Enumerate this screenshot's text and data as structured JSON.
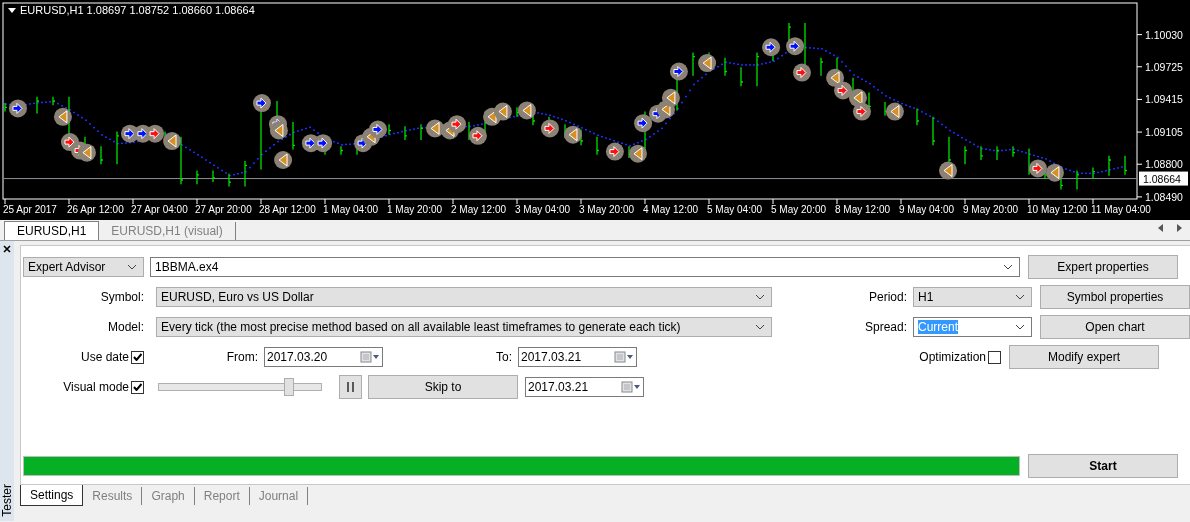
{
  "chart": {
    "title": "EURUSD,H1 1.08697 1.08752 1.08660 1.08664",
    "time_labels": [
      "25 Apr 2017",
      "26 Apr 12:00",
      "27 Apr 04:00",
      "27 Apr 20:00",
      "28 Apr 12:00",
      "1 May 04:00",
      "1 May 20:00",
      "2 May 12:00",
      "3 May 04:00",
      "3 May 20:00",
      "4 May 12:00",
      "5 May 04:00",
      "5 May 20:00",
      "8 May 12:00",
      "9 May 04:00",
      "9 May 20:00",
      "10 May 12:00",
      "11 May 04:00"
    ],
    "price_labels": [
      "1.10030",
      "1.09725",
      "1.09415",
      "1.09105",
      "1.08800",
      "1.08490"
    ],
    "current_price": "1.08664"
  },
  "chart_tabs": [
    {
      "label": "EURUSD,H1",
      "selected": true
    },
    {
      "label": "EURUSD,H1 (visual)",
      "selected": false
    }
  ],
  "tester": {
    "title": "Tester",
    "expert_type": "Expert Advisor",
    "expert_file": "1BBMA.ex4",
    "symbol": {
      "label": "Symbol:",
      "value": "EURUSD, Euro vs US Dollar"
    },
    "model": {
      "label": "Model:",
      "value": "Every tick (the most precise method based on all available least timeframes to generate each tick)"
    },
    "period": {
      "label": "Period:",
      "value": "H1"
    },
    "spread": {
      "label": "Spread:",
      "value": "Current",
      "highlighted": true
    },
    "use_date": {
      "label": "Use date",
      "checked": true
    },
    "from": {
      "label": "From:",
      "value": "2017.03.20"
    },
    "to": {
      "label": "To:",
      "value": "2017.03.21"
    },
    "optimization": {
      "label": "Optimization",
      "checked": false
    },
    "visual_mode": {
      "label": "Visual mode",
      "checked": true
    },
    "speed": {
      "level": 0.8
    },
    "skip_to": {
      "label": "Skip to",
      "value": "2017.03.21"
    },
    "progress": {
      "level": 1
    },
    "buttons": [
      "Expert properties",
      "Symbol properties",
      "Open chart",
      "Modify expert"
    ],
    "start": "Start"
  },
  "bottom_tabs": [
    {
      "label": "Settings",
      "selected": true
    },
    {
      "label": "Results",
      "selected": false
    },
    {
      "label": "Graph",
      "selected": false
    },
    {
      "label": "Report",
      "selected": false
    },
    {
      "label": "Journal",
      "selected": false
    }
  ]
}
